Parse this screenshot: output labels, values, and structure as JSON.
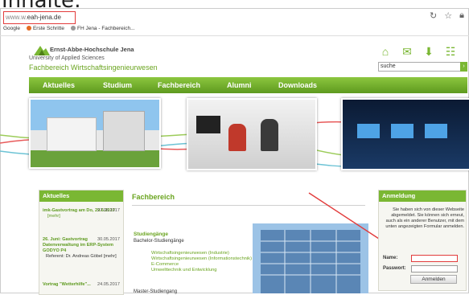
{
  "heading": "Inhalte:",
  "browser": {
    "url_prefix": "www.w.",
    "url_host": "eah-jena.de",
    "bookmarks": [
      "Google",
      "Erste Schritte",
      "FH Jena - Fachbereich..."
    ],
    "icons": [
      "reload-icon",
      "star-icon",
      "lock-icon"
    ]
  },
  "site": {
    "logo_line1": "Ernst-Abbe-Hochschule Jena",
    "logo_line2": "University of Applied Sciences",
    "logo_line3": "Fachbereich Wirtschaftsingenieurwesen",
    "search_value": "suche",
    "search_button": "›",
    "nav": [
      "Aktuelles",
      "Studium",
      "Fachbereich",
      "Alumni",
      "Downloads"
    ]
  },
  "news": {
    "header": "Aktuelles",
    "items": [
      {
        "title": "imk-Gastvortrag am Do, 29.6.2017",
        "date": "27.06.2017",
        "more": "[mehr]",
        "extra": ""
      },
      {
        "title": "26. Juni: Gastvortrag Datenverwaltung im ERP-System GODYO P4",
        "date": "30.05.2017",
        "more": "",
        "extra": "Referent: Dr. Andreas Göbel [mehr]"
      },
      {
        "title": "Vortrag \"Wetterhilfe\"...",
        "date": "24.05.2017",
        "more": "",
        "extra": ""
      }
    ]
  },
  "main": {
    "title": "Fachbereich",
    "studiengaenge": "Studiengänge",
    "bachelor": "Bachelor-Studiengänge",
    "links": [
      "Wirtschaftsingenieurwesen (Industrie)",
      "Wirtschaftsingenieurwesen (Informationstechnik)",
      "E-Commerce",
      "Umwelttechnik und Entwicklung"
    ],
    "master": "Master-Studiengang"
  },
  "login": {
    "header": "Anmeldung",
    "message": "Sie haben sich von dieser Webseite abgemeldet. Sie können sich erneut, auch als ein anderer Benutzer, mit dem unten angezeigten Formular anmelden.",
    "name_label": "Name:",
    "password_label": "Passwort:",
    "button": "Anmelden"
  },
  "colors": {
    "accent": "#7ab733",
    "highlight": "#e23b3b"
  }
}
